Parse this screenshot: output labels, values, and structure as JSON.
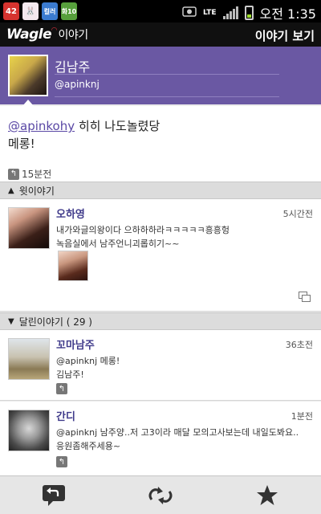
{
  "status_bar": {
    "notifications": [
      "42",
      "🐰",
      "컬러",
      "화10"
    ],
    "network": "LTE",
    "time": "오전 1:35"
  },
  "app_bar": {
    "logo_text": "Wagle",
    "logo_sub": "이야기",
    "action": "이야기 보기"
  },
  "profile": {
    "name": "김남주",
    "handle": "@apinknj"
  },
  "post": {
    "mention": "@apinkohy",
    "text_after_mention": " 히히 나도놀렸당",
    "line2": "메롱!",
    "time": "15분전"
  },
  "sections": {
    "upper": "윗이야기",
    "replies": "달린이야기 ( 29 )"
  },
  "upper_item": {
    "name": "오하영",
    "time": "5시간전",
    "line1": "내가와글의왕이다 으하하하라ㅋㅋㅋㅋㅋ흥흥헝",
    "line2": "녹음실에서 남주언니괴롭히기~~"
  },
  "reply_items": [
    {
      "name": "꼬마남주",
      "time": "36초전",
      "line1": "@apinknj 메롱!",
      "line2": "김남주!"
    },
    {
      "name": "간디",
      "time": "1분전",
      "line1": "@apinknj 남주양..저 고3이라 매달 모의고사보는데 내일도봐요..",
      "line2": "응원좀해주세용~"
    }
  ],
  "toolbar": {
    "reply_icon": "reply-icon",
    "share_icon": "repost-icon",
    "fav_icon": "star-icon"
  },
  "colors": {
    "accent": "#6a58a3",
    "mention": "#5a48a5"
  }
}
